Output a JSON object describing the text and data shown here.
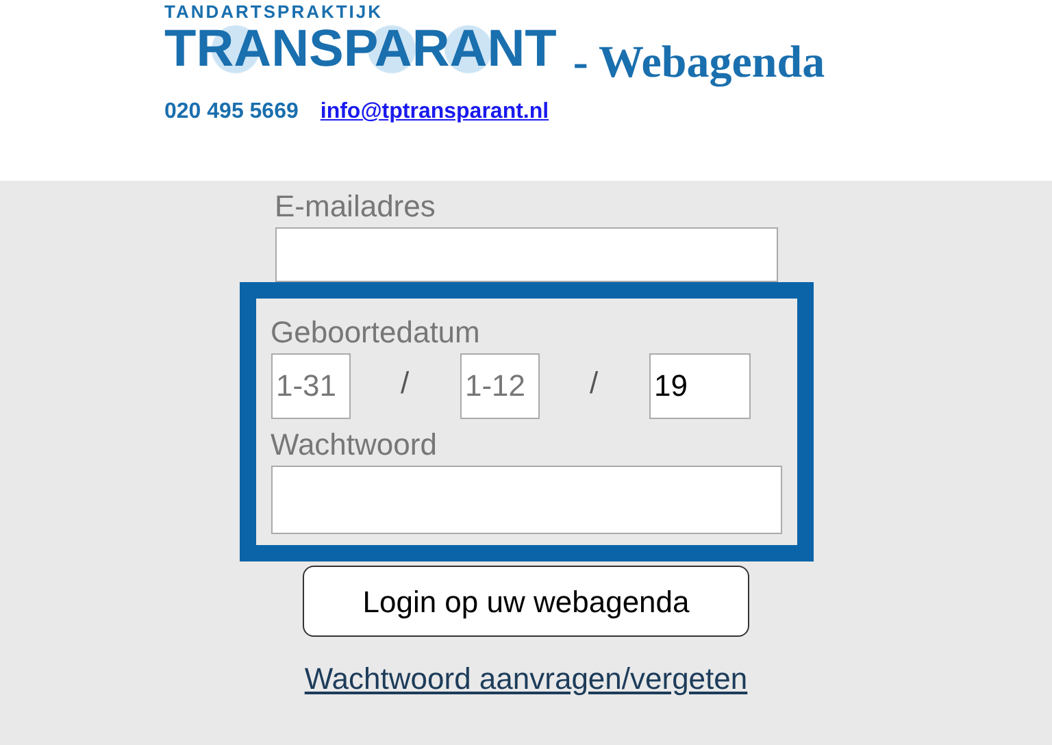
{
  "header": {
    "logo_top": "TANDARTSPRAKTIJK",
    "logo_main": "TRANSPARANT",
    "title": "- Webagenda",
    "phone": "020 495 5669",
    "email": "info@tptransparant.nl"
  },
  "form": {
    "email_label": "E-mailadres",
    "birth_label": "Geboortedatum",
    "day": {
      "placeholder": "1-31"
    },
    "separator_1": "/",
    "month": {
      "placeholder": "1-12"
    },
    "separator_2": "/",
    "year": {
      "value": "19"
    },
    "password_label": "Wachtwoord",
    "highlighted": true,
    "submit": "Login op uw webagenda",
    "forgot_link": "Wachtwoord aanvragen/vergeten"
  }
}
